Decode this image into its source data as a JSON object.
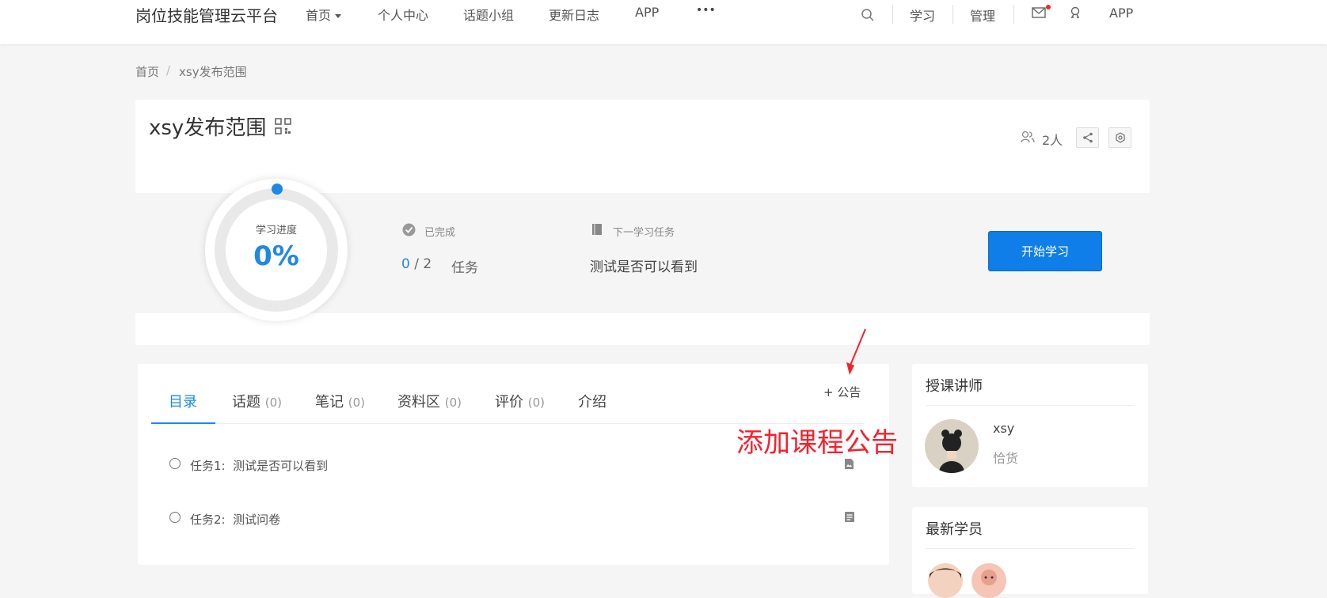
{
  "header": {
    "logo": "岗位技能管理云平台",
    "nav": [
      "首页",
      "个人中心",
      "话题小组",
      "更新日志",
      "APP"
    ],
    "more": "•••",
    "right": {
      "study": "学习",
      "manage": "管理",
      "app": "APP"
    }
  },
  "breadcrumb": {
    "home": "首页",
    "separator": "/",
    "current": "xsy发布范围"
  },
  "course": {
    "title": "xsy发布范围",
    "members": "2人",
    "progress": {
      "label": "学习进度",
      "percent": "0%",
      "value": 0
    },
    "completed": {
      "label": "已完成",
      "done": "0",
      "sep": "/",
      "total": "2",
      "unit": "任务"
    },
    "next": {
      "label": "下一学习任务",
      "task": "测试是否可以看到"
    },
    "start_button": "开始学习"
  },
  "tabs": [
    {
      "label": "目录",
      "count": ""
    },
    {
      "label": "话题",
      "count": "(0)"
    },
    {
      "label": "笔记",
      "count": "(0)"
    },
    {
      "label": "资料区",
      "count": "(0)"
    },
    {
      "label": "评价",
      "count": "(0)"
    },
    {
      "label": "介绍",
      "count": ""
    }
  ],
  "announce": {
    "plus": "+",
    "label": "公告"
  },
  "annotation": "添加课程公告",
  "tasks": [
    {
      "label": "任务1:",
      "title": "测试是否可以看到",
      "icon": "document-icon"
    },
    {
      "label": "任务2:",
      "title": "测试问卷",
      "icon": "survey-icon"
    }
  ],
  "sidebar": {
    "teacher_title": "授课讲师",
    "teacher_name": "xsy",
    "teacher_desc": "恰货",
    "students_title": "最新学员"
  },
  "colors": {
    "accent": "#1e88e5",
    "button": "#0f7ee8",
    "annotation": "#f5222d",
    "background": "#f5f5f5"
  }
}
